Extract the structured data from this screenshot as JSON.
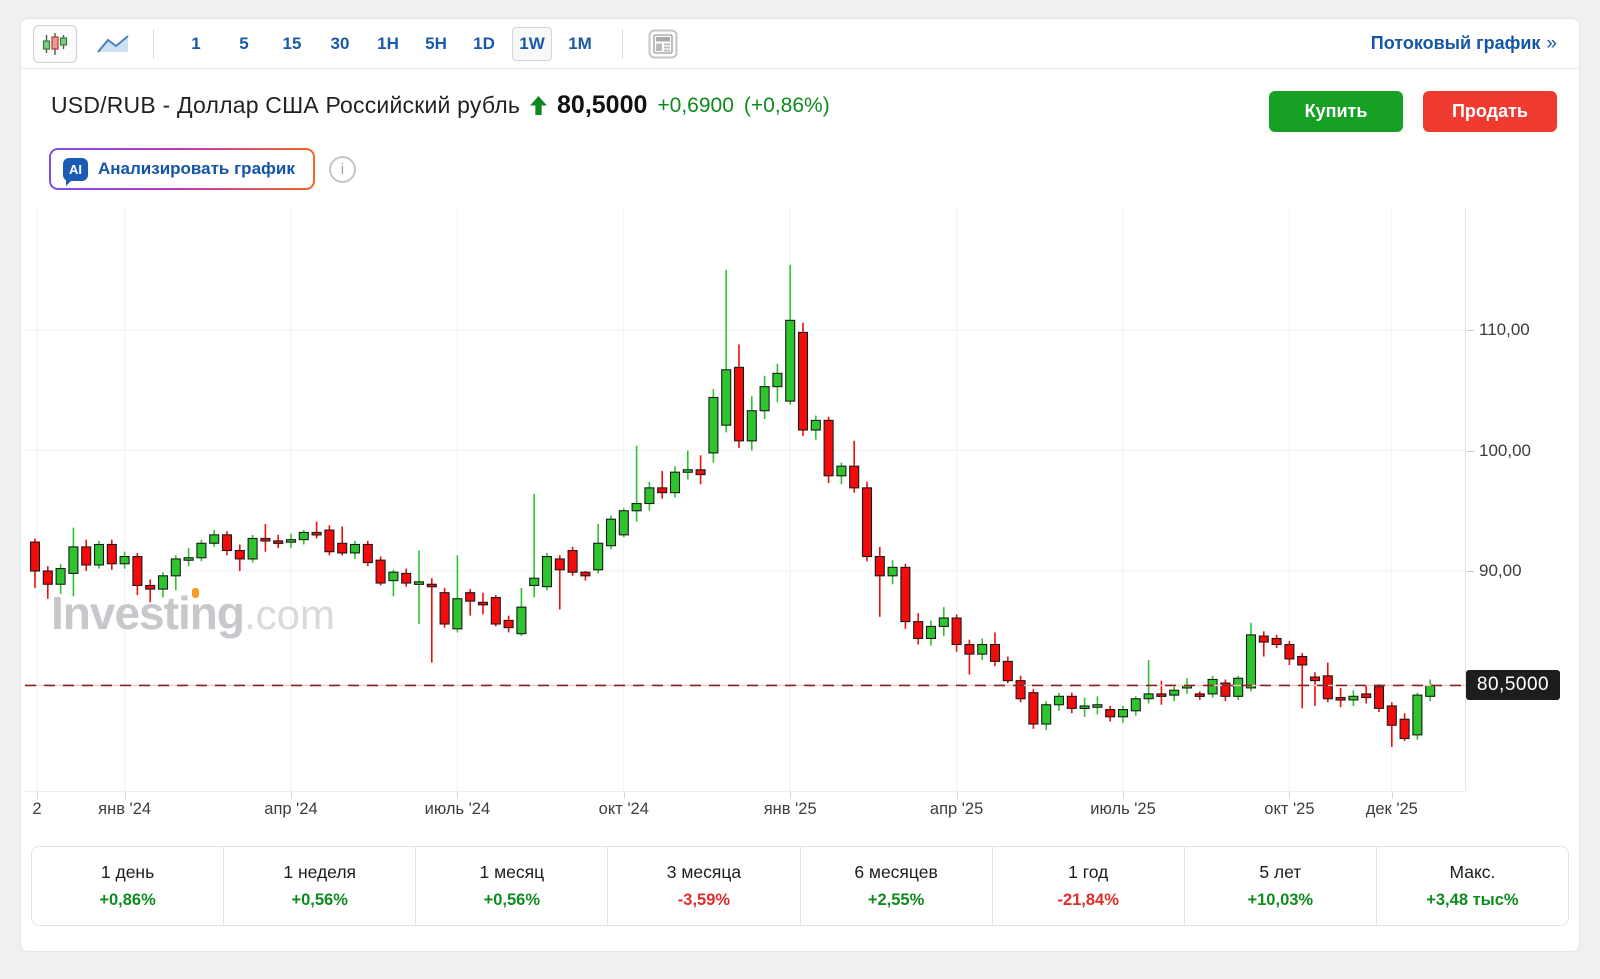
{
  "colors": {
    "accent_blue": "#1b5aa7",
    "up_text": "#0d8a1d",
    "down_text": "#e22c2c",
    "buy_button": "#16a125",
    "sell_button": "#ef3a30",
    "candle_up": "#2dc42d",
    "candle_down": "#f40b0b",
    "candle_outline": "#1b1b1b",
    "dashed_line": "#8b2020",
    "dashed_underlay": "#f6c9c9",
    "price_tag_bg": "#1d1d1d",
    "grid": "#f0f1f3"
  },
  "toolbar": {
    "candlestick_button": "candlestick-chart-type",
    "line_button": "line-chart-type",
    "timeframes": [
      {
        "label": "1",
        "selected": false
      },
      {
        "label": "5",
        "selected": false
      },
      {
        "label": "15",
        "selected": false
      },
      {
        "label": "30",
        "selected": false
      },
      {
        "label": "1H",
        "selected": false
      },
      {
        "label": "5H",
        "selected": false
      },
      {
        "label": "1D",
        "selected": false
      },
      {
        "label": "1W",
        "selected": true
      },
      {
        "label": "1M",
        "selected": false
      }
    ],
    "stream_link": "Потоковый график",
    "stream_chevron": "»"
  },
  "header": {
    "title": "USD/RUB - Доллар США Российский рубль",
    "last_price": "80,5000",
    "change": "+0,6900",
    "change_pct": "(+0,86%)",
    "buy_label": "Купить",
    "sell_label": "Продать"
  },
  "ai_bar": {
    "badge": "AI",
    "label": "Анализировать график",
    "info_glyph": "i"
  },
  "chart": {
    "watermark_main": "Investing",
    "watermark_suffix": ".com",
    "current_price_label": "80,5000",
    "current_price": 80.5,
    "y_ticks": [
      {
        "label": "110,00",
        "price": 110
      },
      {
        "label": "100,00",
        "price": 100
      },
      {
        "label": "90,00",
        "price": 90
      }
    ],
    "x_ticks": [
      {
        "label": "2",
        "i": 1.15
      },
      {
        "label": "янв '24",
        "i": 8
      },
      {
        "label": "апр '24",
        "i": 21
      },
      {
        "label": "июль '24",
        "i": 34
      },
      {
        "label": "окт '24",
        "i": 47
      },
      {
        "label": "янв '25",
        "i": 60
      },
      {
        "label": "апр '25",
        "i": 73
      },
      {
        "label": "июль '25",
        "i": 86
      },
      {
        "label": "окт '25",
        "i": 99
      },
      {
        "label": "дек '25",
        "i": 107
      }
    ]
  },
  "chart_data": {
    "type": "candlestick",
    "symbol": "USD/RUB",
    "interval": "1W",
    "y_range": [
      74,
      117
    ],
    "x_range_labels": [
      "дек '23",
      "дек '25"
    ],
    "current_price": 80.5,
    "ohlc_legend": [
      "open",
      "high",
      "low",
      "close"
    ],
    "ohlc": [
      [
        92.4,
        92.7,
        88.6,
        90.0
      ],
      [
        90.0,
        90.4,
        87.7,
        88.9
      ],
      [
        88.9,
        90.6,
        88.1,
        90.2
      ],
      [
        89.8,
        93.6,
        87.9,
        92.0
      ],
      [
        92.0,
        92.6,
        90.0,
        90.5
      ],
      [
        90.5,
        92.5,
        90.2,
        92.2
      ],
      [
        92.2,
        92.6,
        90.1,
        90.6
      ],
      [
        90.6,
        91.6,
        90.2,
        91.2
      ],
      [
        91.2,
        91.5,
        88.0,
        88.8
      ],
      [
        88.8,
        89.3,
        87.4,
        88.5
      ],
      [
        88.5,
        89.9,
        87.8,
        89.6
      ],
      [
        89.6,
        91.3,
        88.4,
        91.0
      ],
      [
        91.0,
        91.9,
        90.4,
        91.1
      ],
      [
        91.1,
        92.6,
        90.8,
        92.3
      ],
      [
        92.3,
        93.4,
        92.0,
        93.0
      ],
      [
        93.0,
        93.3,
        91.3,
        91.7
      ],
      [
        91.7,
        92.2,
        90.0,
        91.0
      ],
      [
        91.0,
        93.0,
        90.7,
        92.7
      ],
      [
        92.7,
        93.9,
        91.6,
        92.5
      ],
      [
        92.5,
        93.0,
        91.9,
        92.4
      ],
      [
        92.4,
        93.1,
        91.9,
        92.6
      ],
      [
        92.6,
        93.4,
        92.2,
        93.2
      ],
      [
        93.2,
        94.1,
        92.7,
        93.0
      ],
      [
        93.4,
        93.8,
        91.3,
        91.6
      ],
      [
        92.3,
        93.7,
        91.3,
        91.5
      ],
      [
        91.5,
        92.5,
        91.0,
        92.2
      ],
      [
        92.2,
        92.5,
        90.4,
        90.7
      ],
      [
        90.9,
        91.2,
        88.8,
        89.0
      ],
      [
        89.2,
        90.1,
        87.9,
        89.9
      ],
      [
        89.8,
        90.2,
        88.7,
        89.0
      ],
      [
        89.0,
        91.7,
        85.6,
        89.1
      ],
      [
        88.9,
        89.4,
        82.4,
        88.8
      ],
      [
        88.2,
        88.6,
        85.3,
        85.6
      ],
      [
        85.2,
        91.3,
        84.9,
        87.7
      ],
      [
        88.2,
        88.5,
        86.3,
        87.5
      ],
      [
        87.4,
        88.2,
        86.4,
        87.3
      ],
      [
        87.8,
        88.0,
        85.4,
        85.6
      ],
      [
        85.9,
        86.3,
        84.9,
        85.3
      ],
      [
        84.8,
        88.6,
        84.6,
        87.0
      ],
      [
        88.8,
        96.4,
        87.8,
        89.4
      ],
      [
        88.7,
        91.5,
        88.4,
        91.2
      ],
      [
        91.0,
        91.3,
        86.8,
        90.1
      ],
      [
        91.7,
        92.0,
        89.6,
        89.9
      ],
      [
        89.9,
        90.0,
        89.2,
        89.6
      ],
      [
        90.1,
        93.9,
        89.8,
        92.3
      ],
      [
        92.1,
        94.6,
        91.8,
        94.3
      ],
      [
        93.0,
        95.2,
        92.8,
        95.0
      ],
      [
        95.0,
        100.4,
        94.1,
        95.6
      ],
      [
        95.6,
        97.4,
        95.0,
        96.9
      ],
      [
        96.9,
        98.3,
        96.0,
        96.5
      ],
      [
        96.5,
        98.7,
        96.1,
        98.2
      ],
      [
        98.2,
        100.0,
        97.6,
        98.4
      ],
      [
        98.4,
        99.6,
        97.2,
        98.0
      ],
      [
        99.8,
        105.1,
        99.0,
        104.4
      ],
      [
        102.1,
        115.0,
        101.5,
        106.7
      ],
      [
        106.9,
        108.8,
        100.2,
        100.8
      ],
      [
        100.8,
        104.5,
        100.0,
        103.3
      ],
      [
        103.3,
        106.2,
        102.6,
        105.3
      ],
      [
        105.3,
        107.2,
        104.0,
        106.4
      ],
      [
        104.1,
        115.4,
        103.8,
        110.8
      ],
      [
        109.8,
        110.6,
        101.2,
        101.7
      ],
      [
        101.7,
        102.9,
        100.9,
        102.5
      ],
      [
        102.5,
        102.8,
        97.3,
        97.9
      ],
      [
        97.9,
        99.0,
        97.2,
        98.7
      ],
      [
        98.7,
        100.8,
        96.5,
        96.9
      ],
      [
        96.9,
        97.4,
        90.8,
        91.2
      ],
      [
        91.2,
        92.0,
        86.2,
        89.6
      ],
      [
        89.6,
        90.9,
        88.9,
        90.3
      ],
      [
        90.3,
        90.6,
        85.2,
        85.8
      ],
      [
        85.8,
        86.5,
        83.9,
        84.4
      ],
      [
        84.4,
        85.9,
        83.8,
        85.4
      ],
      [
        85.4,
        87.0,
        84.6,
        86.1
      ],
      [
        86.1,
        86.4,
        83.3,
        83.9
      ],
      [
        83.9,
        84.3,
        81.4,
        83.1
      ],
      [
        83.1,
        84.4,
        82.6,
        83.9
      ],
      [
        83.9,
        84.9,
        82.1,
        82.5
      ],
      [
        82.5,
        82.9,
        80.7,
        80.9
      ],
      [
        80.9,
        81.3,
        79.1,
        79.4
      ],
      [
        79.9,
        80.2,
        76.9,
        77.3
      ],
      [
        77.3,
        79.2,
        76.8,
        78.9
      ],
      [
        78.9,
        79.9,
        78.4,
        79.6
      ],
      [
        79.6,
        79.9,
        78.2,
        78.6
      ],
      [
        78.6,
        79.5,
        77.9,
        78.8
      ],
      [
        78.8,
        79.6,
        78.1,
        78.9
      ],
      [
        78.5,
        78.8,
        77.5,
        77.9
      ],
      [
        77.9,
        78.8,
        77.4,
        78.5
      ],
      [
        78.4,
        79.6,
        78.0,
        79.4
      ],
      [
        79.4,
        82.6,
        79.0,
        79.8
      ],
      [
        79.8,
        80.9,
        78.9,
        79.7
      ],
      [
        79.7,
        80.4,
        79.2,
        80.1
      ],
      [
        80.3,
        81.1,
        79.8,
        80.5
      ],
      [
        79.8,
        80.0,
        79.3,
        79.7
      ],
      [
        79.8,
        81.3,
        79.5,
        81.0
      ],
      [
        80.7,
        81.0,
        79.2,
        79.6
      ],
      [
        79.6,
        81.3,
        79.3,
        81.1
      ],
      [
        80.3,
        85.7,
        80.0,
        84.7
      ],
      [
        84.6,
        85.0,
        82.9,
        84.1
      ],
      [
        84.4,
        84.7,
        83.6,
        83.9
      ],
      [
        83.9,
        84.2,
        82.2,
        82.7
      ],
      [
        82.9,
        83.2,
        78.6,
        82.2
      ],
      [
        81.2,
        81.6,
        78.8,
        80.9
      ],
      [
        81.3,
        82.4,
        79.1,
        79.4
      ],
      [
        79.5,
        80.3,
        78.7,
        79.3
      ],
      [
        79.3,
        80.1,
        78.8,
        79.6
      ],
      [
        79.8,
        80.5,
        79.0,
        79.5
      ],
      [
        80.4,
        80.6,
        78.3,
        78.6
      ],
      [
        78.8,
        79.1,
        75.4,
        77.2
      ],
      [
        77.7,
        78.2,
        75.9,
        76.1
      ],
      [
        76.4,
        79.9,
        76.0,
        79.7
      ],
      [
        79.6,
        81.0,
        79.2,
        80.5
      ]
    ]
  },
  "stats": [
    {
      "label": "1 день",
      "value": "+0,86%",
      "dir": "up"
    },
    {
      "label": "1 неделя",
      "value": "+0,56%",
      "dir": "up"
    },
    {
      "label": "1 месяц",
      "value": "+0,56%",
      "dir": "up"
    },
    {
      "label": "3 месяца",
      "value": "-3,59%",
      "dir": "down"
    },
    {
      "label": "6 месяцев",
      "value": "+2,55%",
      "dir": "up"
    },
    {
      "label": "1 год",
      "value": "-21,84%",
      "dir": "down"
    },
    {
      "label": "5 лет",
      "value": "+10,03%",
      "dir": "up"
    },
    {
      "label": "Макс.",
      "value": "+3,48 тыс%",
      "dir": "up"
    }
  ]
}
